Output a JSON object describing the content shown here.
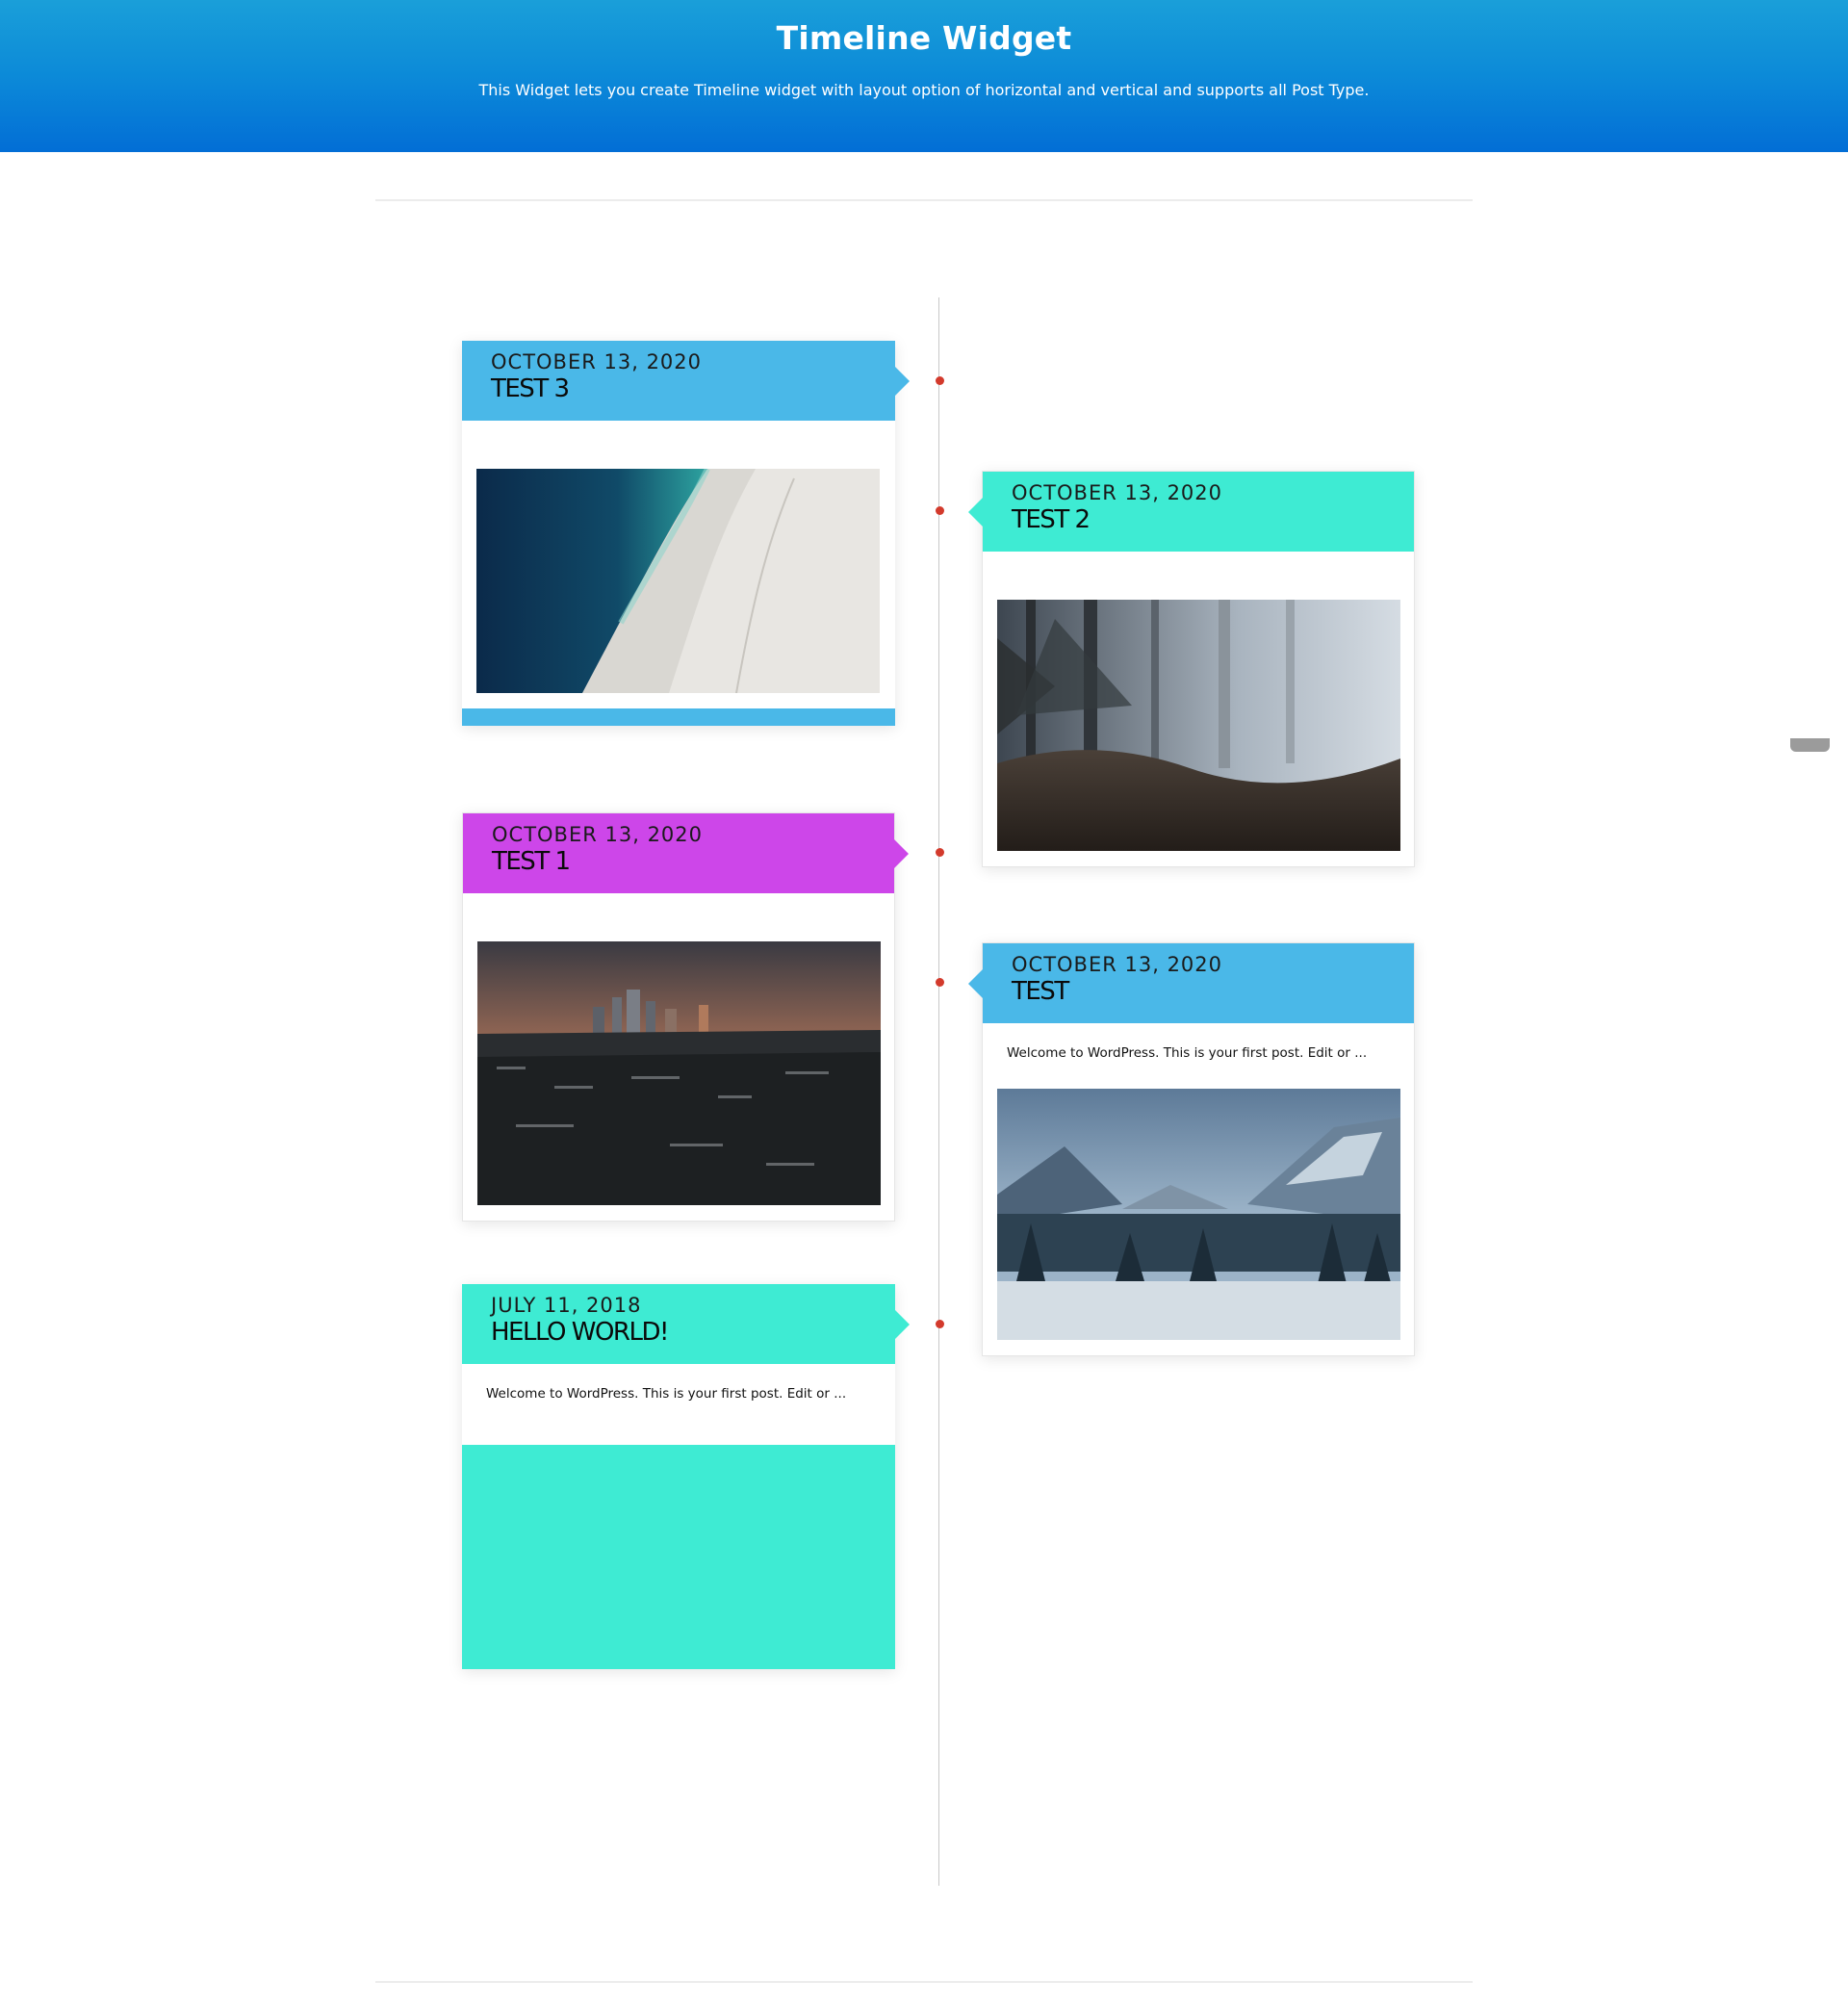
{
  "header": {
    "title": "Timeline Widget",
    "subtitle": "This Widget lets you create Timeline widget with layout option of horizontal and vertical and supports all Post Type."
  },
  "colors": {
    "blue": "#4ab8e8",
    "teal": "#3eebd3",
    "purple": "#cd46e9",
    "dot": "#d33a2c"
  },
  "timeline": {
    "items": [
      {
        "date": "OCTOBER 13, 2020",
        "title": "TEST 3",
        "excerpt": "",
        "image": "aerial-beach-photo",
        "accent": "#4ab8e8"
      },
      {
        "date": "OCTOBER 13, 2020",
        "title": "TEST 2",
        "excerpt": "",
        "image": "misty-forest-photo",
        "accent": "#3eebd3"
      },
      {
        "date": "OCTOBER 13, 2020",
        "title": "TEST 1",
        "excerpt": "",
        "image": "city-skyline-photo",
        "accent": "#cd46e9"
      },
      {
        "date": "OCTOBER 13, 2020",
        "title": "TEST",
        "excerpt": "Welcome to WordPress. This is your first post. Edit or ...",
        "image": "snowy-mountains-photo",
        "accent": "#4ab8e8"
      },
      {
        "date": "JULY 11, 2018",
        "title": "HELLO WORLD!",
        "excerpt": "Welcome to WordPress. This is your first post. Edit or ...",
        "image": "",
        "accent": "#3eebd3"
      }
    ]
  }
}
